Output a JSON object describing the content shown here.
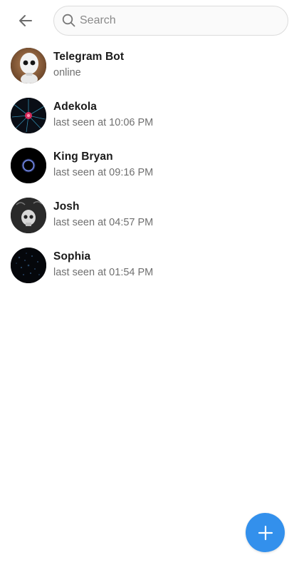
{
  "colors": {
    "accent": "#3390ec",
    "name_text": "#1a1a1a",
    "status_text": "#707070",
    "search_border": "#dcdcdc"
  },
  "header": {
    "back_icon": "arrow-left-icon",
    "search": {
      "placeholder": "Search",
      "value": "",
      "icon": "search-icon"
    }
  },
  "contacts": [
    {
      "name": "Telegram Bot",
      "status": "online",
      "avatar": "robot-photo"
    },
    {
      "name": "Adekola",
      "status": "last seen at 10:06 PM",
      "avatar": "red-burst-photo"
    },
    {
      "name": "King Bryan",
      "status": "last seen at 09:16 PM",
      "avatar": "blue-ring-photo"
    },
    {
      "name": "Josh",
      "status": "last seen at 04:57 PM",
      "avatar": "skull-photo"
    },
    {
      "name": "Sophia",
      "status": "last seen at 01:54 PM",
      "avatar": "dark-pattern-photo"
    }
  ],
  "fab": {
    "icon": "plus-icon"
  }
}
